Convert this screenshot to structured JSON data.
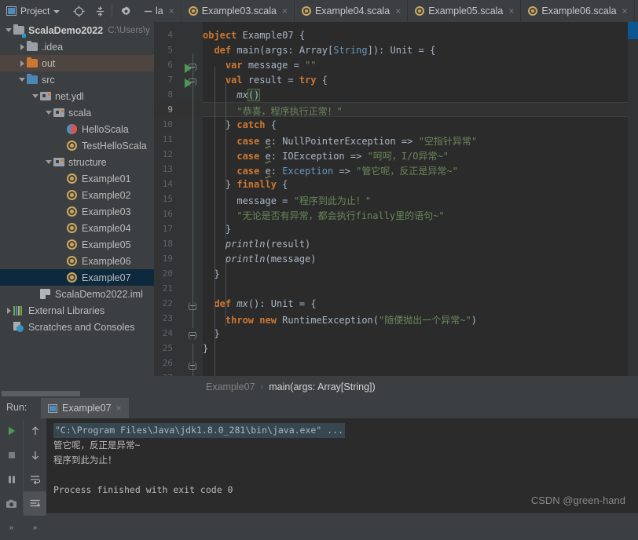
{
  "window": {
    "toolbar": {
      "project_button": "Project",
      "icons": [
        "locate-icon",
        "collapse-all-icon",
        "settings-gear-icon",
        "minimize-icon"
      ]
    }
  },
  "tabs": [
    {
      "label": "la",
      "icon": "scala-class-icon",
      "partial": true,
      "active": false
    },
    {
      "label": "Example03.scala",
      "icon": "scala-object-icon",
      "active": false
    },
    {
      "label": "Example04.scala",
      "icon": "scala-object-icon",
      "active": false
    },
    {
      "label": "Example05.scala",
      "icon": "scala-object-icon",
      "active": false
    },
    {
      "label": "Example06.scala",
      "icon": "scala-object-icon",
      "active": false
    }
  ],
  "sidebar": {
    "items": [
      {
        "label": "ScalaDemo2022",
        "suffix": "C:\\Users\\y",
        "icon": "module-folder-icon",
        "arrow": "open",
        "depth": 0,
        "bold": true,
        "state": "normal"
      },
      {
        "label": ".idea",
        "icon": "folder-gray-icon",
        "arrow": "closed",
        "depth": 1,
        "state": "normal"
      },
      {
        "label": "out",
        "icon": "folder-orange-icon",
        "arrow": "closed",
        "depth": 1,
        "state": "hover"
      },
      {
        "label": "src",
        "icon": "folder-blue-icon",
        "arrow": "open",
        "depth": 1,
        "state": "normal"
      },
      {
        "label": "net.ydl",
        "icon": "package-icon",
        "arrow": "open",
        "depth": 2,
        "state": "normal"
      },
      {
        "label": "scala",
        "icon": "package-icon",
        "arrow": "open",
        "depth": 3,
        "state": "normal"
      },
      {
        "label": "HelloScala",
        "icon": "scala-class-icon",
        "arrow": "none",
        "depth": 4,
        "state": "normal"
      },
      {
        "label": "TestHelloScala",
        "icon": "scala-object-icon",
        "arrow": "none",
        "depth": 4,
        "state": "normal"
      },
      {
        "label": "structure",
        "icon": "package-icon",
        "arrow": "open",
        "depth": 3,
        "state": "normal"
      },
      {
        "label": "Example01",
        "icon": "scala-object-icon",
        "arrow": "none",
        "depth": 4,
        "state": "normal"
      },
      {
        "label": "Example02",
        "icon": "scala-object-icon",
        "arrow": "none",
        "depth": 4,
        "state": "normal"
      },
      {
        "label": "Example03",
        "icon": "scala-object-icon",
        "arrow": "none",
        "depth": 4,
        "state": "normal"
      },
      {
        "label": "Example04",
        "icon": "scala-object-icon",
        "arrow": "none",
        "depth": 4,
        "state": "normal"
      },
      {
        "label": "Example05",
        "icon": "scala-object-icon",
        "arrow": "none",
        "depth": 4,
        "state": "normal"
      },
      {
        "label": "Example06",
        "icon": "scala-object-icon",
        "arrow": "none",
        "depth": 4,
        "state": "normal"
      },
      {
        "label": "Example07",
        "icon": "scala-object-icon",
        "arrow": "none",
        "depth": 4,
        "state": "selected"
      },
      {
        "label": "ScalaDemo2022.iml",
        "icon": "iml-file-icon",
        "arrow": "none",
        "depth": 2,
        "state": "normal"
      },
      {
        "label": "External Libraries",
        "icon": "libraries-icon",
        "arrow": "closed",
        "depth": 0,
        "state": "normal"
      },
      {
        "label": "Scratches and Consoles",
        "icon": "scratches-icon",
        "arrow": "none",
        "depth": 0,
        "state": "normal"
      }
    ]
  },
  "editor": {
    "first_line": 4,
    "current_line": 9,
    "lines": [
      {
        "n": 4,
        "indent": 0,
        "html": "<span class=\"kw\">object</span> <span class=\"cls2\">Example07</span> {"
      },
      {
        "n": 5,
        "indent": 0,
        "html": "  <span class=\"kw\">def</span> <span class=\"fn\">main</span>(<span class=\"param\">args</span>: <span class=\"cls2\">Array</span>[<span class=\"cls\">String</span>]): <span class=\"cls2\">Unit</span> = {"
      },
      {
        "n": 6,
        "indent": 0,
        "html": "    <span class=\"kw\">var</span> message = <span class=\"str\">\"\"</span>"
      },
      {
        "n": 7,
        "indent": 0,
        "html": "    <span class=\"kw\">val</span> result = <span class=\"kw\">try</span> {"
      },
      {
        "n": 8,
        "indent": 0,
        "html": "      <span class=\"ital\">mx</span><span class=\"err-box\">()</span><span class=\"caret-bar\"></span>"
      },
      {
        "n": 9,
        "indent": 0,
        "html": "      <span class=\"str\">\"恭喜，程序执行正常！\"</span>"
      },
      {
        "n": 10,
        "indent": 0,
        "html": "    } <span class=\"kw\">catch</span> {"
      },
      {
        "n": 11,
        "indent": 0,
        "html": "      <span class=\"kw\">case</span> <span class=\"uvar\">e</span>: <span class=\"cls2\">NullPointerException</span> =&gt; <span class=\"str\">\"空指针异常\"</span>"
      },
      {
        "n": 12,
        "indent": 0,
        "html": "      <span class=\"kw\">case</span> <span class=\"uvar\">e</span>: <span class=\"cls2\">IOException</span> =&gt; <span class=\"str\">\"呵呵，I/O异常~\"</span>"
      },
      {
        "n": 13,
        "indent": 0,
        "html": "      <span class=\"kw\">case</span> <span class=\"uvar\">e</span>: <span class=\"cls\">Exception</span> =&gt; <span class=\"str\">\"管它呢，反正是异常~\"</span>"
      },
      {
        "n": 14,
        "indent": 0,
        "html": "    } <span class=\"kw\">finally</span> {"
      },
      {
        "n": 15,
        "indent": 0,
        "html": "      message = <span class=\"str\">\"程序到此为止！\"</span>"
      },
      {
        "n": 16,
        "indent": 0,
        "html": "      <span class=\"str\">\"无论是否有异常，都会执行finally里的语句~\"</span>"
      },
      {
        "n": 17,
        "indent": 0,
        "html": "    }"
      },
      {
        "n": 18,
        "indent": 0,
        "html": "    <span class=\"ital\">println</span>(result)"
      },
      {
        "n": 19,
        "indent": 0,
        "html": "    <span class=\"ital\">println</span>(message)"
      },
      {
        "n": 20,
        "indent": 0,
        "html": "  }"
      },
      {
        "n": 21,
        "indent": 0,
        "html": ""
      },
      {
        "n": 22,
        "indent": 0,
        "html": "  <span class=\"kw\">def</span> <span class=\"ital\">mx</span>(): <span class=\"cls2\">Unit</span> = {"
      },
      {
        "n": 23,
        "indent": 0,
        "html": "    <span class=\"kw\">throw new</span> <span class=\"cls2\">RuntimeException</span>(<span class=\"str\">\"随便抛出一个异常~\"</span>)"
      },
      {
        "n": 24,
        "indent": 0,
        "html": "  }"
      },
      {
        "n": 25,
        "indent": 0,
        "html": "}"
      },
      {
        "n": 26,
        "indent": 0,
        "html": ""
      },
      {
        "n": 27,
        "indent": 0,
        "html": ""
      }
    ],
    "breadcrumb": [
      {
        "label": "Example07",
        "active": false
      },
      {
        "label": "main(args: Array[String])",
        "active": true
      }
    ],
    "breadcrumb_separator": "›"
  },
  "run_panel": {
    "label": "Run:",
    "tab_name": "Example07",
    "tab_close": "×",
    "buttons": [
      {
        "name": "rerun-button",
        "glyph": "play"
      },
      {
        "name": "stop-button",
        "glyph": "stop"
      },
      {
        "name": "pause-button",
        "glyph": "pause"
      },
      {
        "name": "screenshot-button",
        "glyph": "camera"
      },
      {
        "name": "more-left-button",
        "glyph": "chevrons"
      },
      {
        "name": "scroll-up-button",
        "glyph": "up"
      },
      {
        "name": "scroll-down-button",
        "glyph": "down"
      },
      {
        "name": "soft-wrap-button",
        "glyph": "wrap"
      },
      {
        "name": "scroll-to-end-button",
        "glyph": "scroll-end",
        "active": true
      },
      {
        "name": "more-right-button",
        "glyph": "chevrons"
      }
    ],
    "console": [
      {
        "text": "\"C:\\Program Files\\Java\\jdk1.8.0_281\\bin\\java.exe\" ...",
        "style": "cmd"
      },
      {
        "text": "管它呢，反正是异常~",
        "style": "out"
      },
      {
        "text": "程序到此为止！",
        "style": "out"
      },
      {
        "text": "",
        "style": "out"
      },
      {
        "text": "Process finished with exit code 0",
        "style": "out"
      }
    ]
  },
  "watermark": "CSDN @green-hand",
  "colors": {
    "keyword": "#cc7832",
    "string": "#6a8759",
    "type": "#6897bb",
    "editor_bg": "#2b2b2b",
    "chrome_bg": "#3c3f41",
    "selection": "#0d293e"
  }
}
